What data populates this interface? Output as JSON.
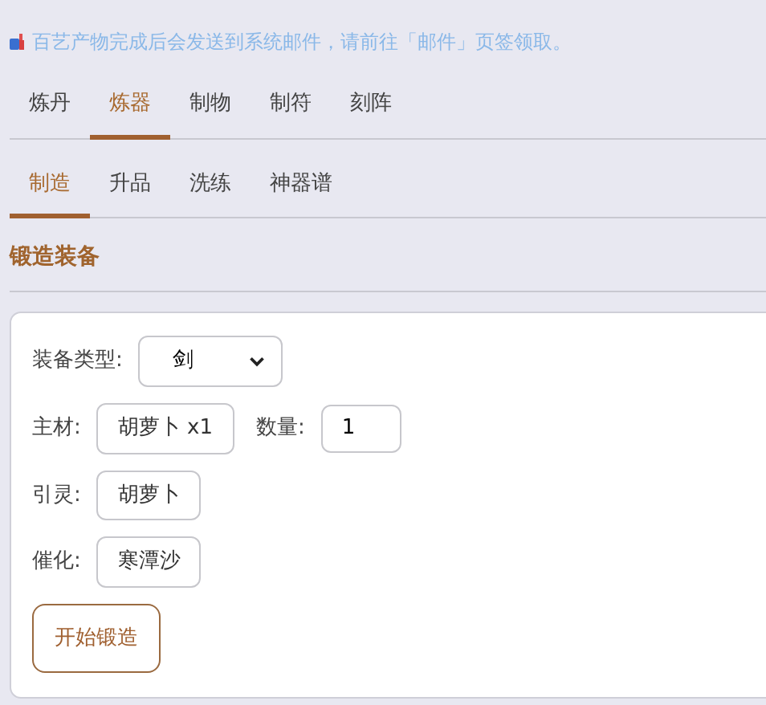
{
  "notice": "百艺产物完成后会发送到系统邮件，请前往「邮件」页签领取。",
  "tabs": [
    {
      "label": "炼丹",
      "selected": false
    },
    {
      "label": "炼器",
      "selected": true
    },
    {
      "label": "制物",
      "selected": false
    },
    {
      "label": "制符",
      "selected": false
    },
    {
      "label": "刻阵",
      "selected": false
    }
  ],
  "subtabs": [
    {
      "label": "制造",
      "selected": true
    },
    {
      "label": "升品",
      "selected": false
    },
    {
      "label": "洗练",
      "selected": false
    },
    {
      "label": "神器谱",
      "selected": false
    }
  ],
  "section_title": "锻造装备",
  "form": {
    "equip_type": {
      "label": "装备类型:",
      "value": "剑"
    },
    "main_material": {
      "label": "主材:",
      "value": "胡萝卜 x1"
    },
    "quantity": {
      "label": "数量:",
      "value": "1"
    },
    "spirit": {
      "label": "引灵:",
      "value": "胡萝卜"
    },
    "catalyst": {
      "label": "催化:",
      "value": "寒潭沙"
    },
    "submit": "开始锻造"
  }
}
